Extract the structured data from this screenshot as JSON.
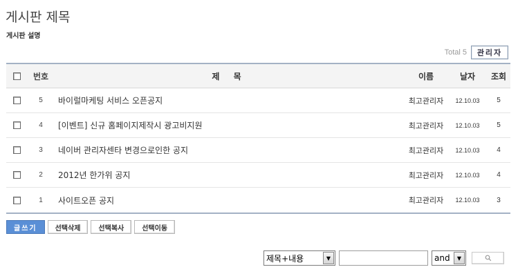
{
  "board": {
    "title": "게시판 제목",
    "description": "게시판 설명",
    "total_label": "Total 5",
    "admin_button": "관리자"
  },
  "table": {
    "headers": {
      "num": "번호",
      "title": "제 목",
      "name": "이름",
      "date": "날자",
      "views": "조회"
    },
    "rows": [
      {
        "num": "5",
        "title": "바이럴마케팅 서비스 오픈공지",
        "name": "최고관리자",
        "date": "12.10.03",
        "views": "5"
      },
      {
        "num": "4",
        "title": "[이벤트] 신규 홈페이지제작시 광고비지원",
        "name": "최고관리자",
        "date": "12.10.03",
        "views": "5"
      },
      {
        "num": "3",
        "title": "네이버 관리자센타 변경으로인한 공지",
        "name": "최고관리자",
        "date": "12.10.03",
        "views": "4"
      },
      {
        "num": "2",
        "title": "2012년 한가위 공지",
        "name": "최고관리자",
        "date": "12.10.03",
        "views": "4"
      },
      {
        "num": "1",
        "title": "사이트오픈 공지",
        "name": "최고관리자",
        "date": "12.10.03",
        "views": "3"
      }
    ]
  },
  "actions": {
    "write": "글쓰기",
    "delete_selected": "선택삭제",
    "copy_selected": "선택복사",
    "move_selected": "선택이동"
  },
  "search": {
    "field_selected": "제목+내용",
    "keyword_value": "",
    "operator_selected": "and",
    "dropdown_arrow": "▼",
    "button_icon": "search-icon"
  }
}
